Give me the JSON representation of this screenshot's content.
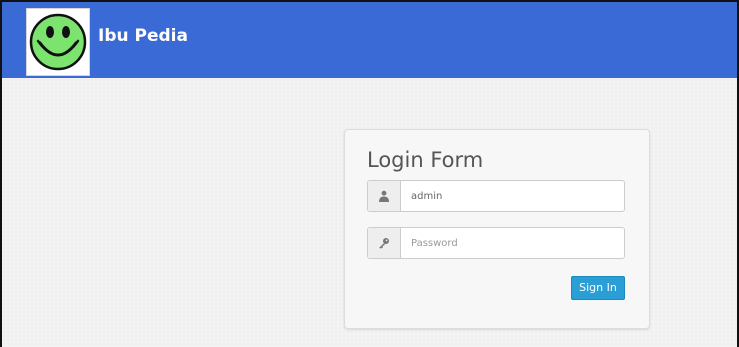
{
  "navbar": {
    "brand": "Ibu Pedia",
    "logo_icon": "smiley-face-icon",
    "background_color": "#3a6ad6"
  },
  "login_form": {
    "title": "Login Form",
    "username": {
      "value": "admin",
      "icon": "user-icon"
    },
    "password": {
      "value": "",
      "placeholder": "Password",
      "icon": "key-icon"
    },
    "submit_label": "Sign In",
    "submit_color": "#2a9fd6"
  }
}
